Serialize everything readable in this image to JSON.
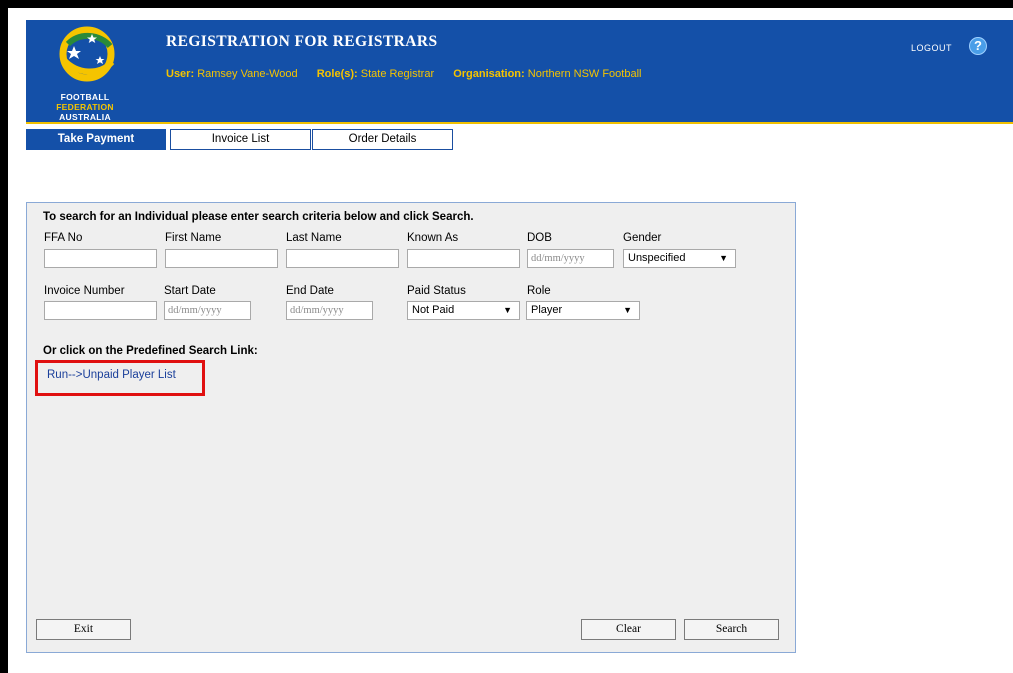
{
  "app_title": "REGISTRATION FOR REGISTRARS",
  "logo": {
    "line1": "FOOTBALL",
    "line2": "FEDERATION",
    "line3": "AUSTRALIA"
  },
  "user_info": {
    "user_label": "User:",
    "user_value": "Ramsey Vane-Wood",
    "roles_label": "Role(s):",
    "roles_value": "State Registrar",
    "org_label": "Organisation:",
    "org_value": "Northern NSW Football"
  },
  "header_actions": {
    "logout": "LOGOUT",
    "help_glyph": "?"
  },
  "tabs": [
    {
      "label": "Take Payment",
      "active": true
    },
    {
      "label": "Invoice List",
      "active": false
    },
    {
      "label": "Order Details",
      "active": false
    }
  ],
  "search": {
    "instructions": "To search for an Individual please enter search criteria below and click Search.",
    "row1": {
      "ffa_no": {
        "label": "FFA No",
        "value": ""
      },
      "first_name": {
        "label": "First Name",
        "value": ""
      },
      "last_name": {
        "label": "Last Name",
        "value": ""
      },
      "known_as": {
        "label": "Known As",
        "value": ""
      },
      "dob": {
        "label": "DOB",
        "placeholder": "dd/mm/yyyy"
      },
      "gender": {
        "label": "Gender",
        "value": "Unspecified"
      }
    },
    "row2": {
      "invoice_number": {
        "label": "Invoice Number",
        "value": ""
      },
      "start_date": {
        "label": "Start Date",
        "placeholder": "dd/mm/yyyy"
      },
      "end_date": {
        "label": "End Date",
        "placeholder": "dd/mm/yyyy"
      },
      "paid_status": {
        "label": "Paid Status",
        "value": "Not Paid"
      },
      "role": {
        "label": "Role",
        "value": "Player"
      }
    }
  },
  "predefined": {
    "heading": "Or click on the Predefined Search Link:",
    "link": "Run-->Unpaid Player List"
  },
  "buttons": {
    "exit": "Exit",
    "clear": "Clear",
    "search": "Search"
  },
  "colors": {
    "header_blue": "#1450a8",
    "accent_gold": "#f5c400",
    "highlight_red": "#e01010"
  }
}
